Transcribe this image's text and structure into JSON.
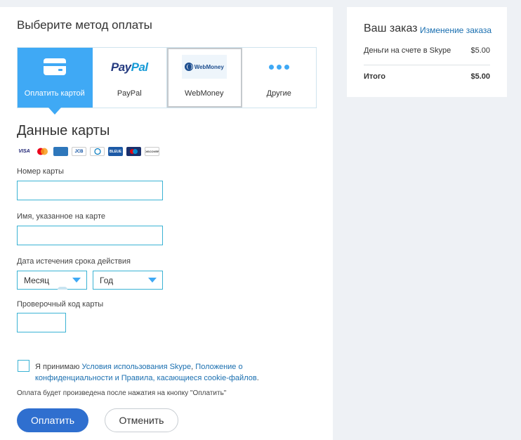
{
  "payment": {
    "title": "Выберите метод оплаты",
    "tabs": [
      {
        "label": "Оплатить картой",
        "icon": "credit-card-icon",
        "active": true
      },
      {
        "label": "PayPal",
        "logo_pay": "Pay",
        "logo_pal": "Pal"
      },
      {
        "label": "WebMoney",
        "logo": "WebMoney"
      },
      {
        "label": "Другие",
        "icon": "more-dots-icon"
      }
    ]
  },
  "card": {
    "title": "Данные карты",
    "logos": [
      "VISA",
      "MC",
      "AMEX",
      "JCB",
      "DC",
      "BLEUE",
      "MAESTRO",
      "DISCOVER"
    ]
  },
  "form": {
    "card_number_label": "Номер карты",
    "card_number_value": "",
    "name_label": "Имя, указанное на карте",
    "name_value": "",
    "expiry_label": "Дата истечения срока действия",
    "month_value": "Месяц",
    "year_value": "Год",
    "cvv_label": "Проверочный код карты",
    "cvv_value": ""
  },
  "terms": {
    "prefix": "Я принимаю ",
    "link1": "Условия использования Skype",
    "sep": ", ",
    "link2": "Положение о конфиденциальности и Правила, касающиеся cookie-файлов",
    "suffix": ".",
    "note": "Оплата будет произведена после нажатия на кнопку \"Оплатить\""
  },
  "actions": {
    "pay_label": "Оплатить",
    "cancel_label": "Отменить"
  },
  "order": {
    "title": "Ваш заказ",
    "change_link": "Изменение заказа",
    "item_name": "Деньги на счете в Skype",
    "item_price": "$5.00",
    "total_label": "Итого",
    "total_price": "$5.00"
  },
  "colors": {
    "accent": "#3fa9f5",
    "button_primary": "#2f6fcf",
    "link": "#1a6fb0",
    "input_border": "#3bb3d4"
  }
}
